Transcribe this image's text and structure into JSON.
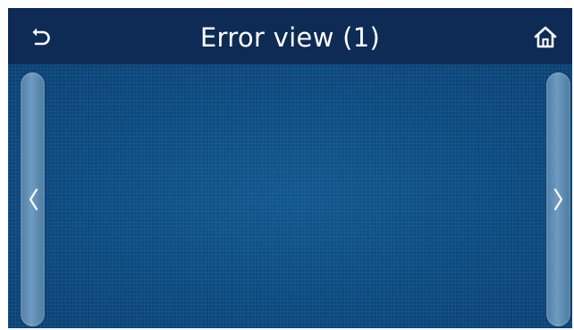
{
  "header": {
    "title": "Error view (1)",
    "back_icon": "back-arrow-icon",
    "home_icon": "home-icon"
  },
  "nav": {
    "prev_icon": "chevron-left-icon",
    "next_icon": "chevron-right-icon"
  },
  "colors": {
    "header_bg": "#0d2b54",
    "content_bg": "#0c4a80",
    "side_button": "#6f9bc0",
    "text": "#ffffff"
  }
}
